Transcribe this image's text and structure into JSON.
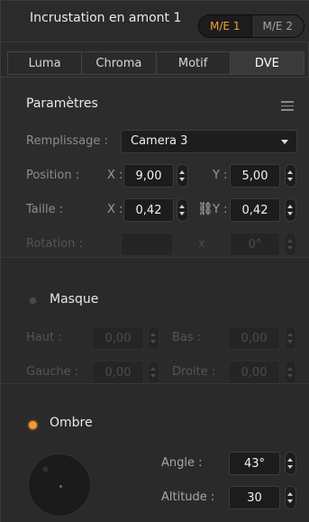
{
  "header": {
    "title": "Incrustation en amont 1",
    "me_buttons": [
      "M/E 1",
      "M/E 2"
    ],
    "active_me": "M/E 1"
  },
  "tabs": [
    "Luma",
    "Chroma",
    "Motif",
    "DVE"
  ],
  "selected_tab": "DVE",
  "parametres": {
    "title": "Paramètres",
    "menu_icon": "hamburger-menu-icon",
    "fill_label": "Remplissage :",
    "fill_value": "Camera 3",
    "position": {
      "label": "Position :",
      "x_axis": "X :",
      "x": "9,00",
      "y_axis": "Y :",
      "y": "5,00"
    },
    "size": {
      "label": "Taille :",
      "x_axis": "X :",
      "x": "0,42",
      "y_axis": "Y :",
      "y": "0,42",
      "link_icon": "chain-link-icon"
    },
    "rotation": {
      "label": "Rotation :",
      "value_left": "",
      "x_axis": "x",
      "value": "0°"
    }
  },
  "masque": {
    "title": "Masque",
    "enabled": false,
    "top": {
      "label": "Haut :",
      "value": "0,00"
    },
    "bottom": {
      "label": "Bas :",
      "value": "0,00"
    },
    "left": {
      "label": "Gauche :",
      "value": "0,00"
    },
    "right": {
      "label": "Droite :",
      "value": "0,00"
    }
  },
  "ombre": {
    "title": "Ombre",
    "enabled": true,
    "angle": {
      "label": "Angle :",
      "value": "43°"
    },
    "altitude": {
      "label": "Altitude :",
      "value": "30"
    },
    "dial_icon": "light-source-icon"
  },
  "colors": {
    "accent": "#f29a32",
    "panel_bg": "#2a2a2a",
    "field_bg": "#1c1c1c"
  }
}
